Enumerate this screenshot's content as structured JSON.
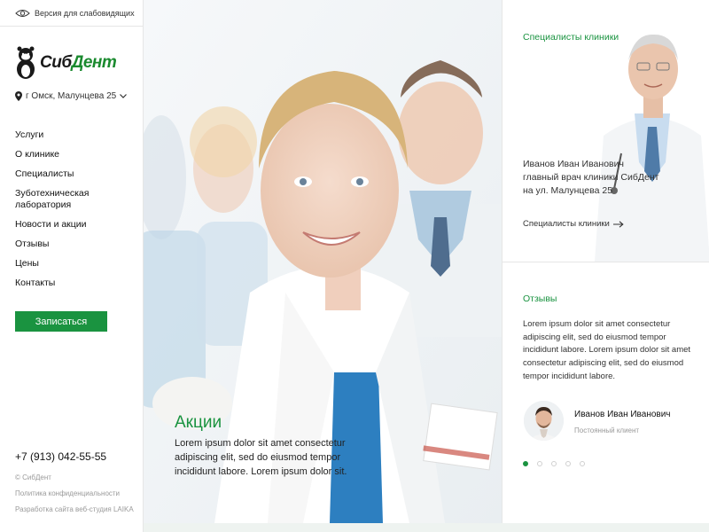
{
  "accessibility": {
    "label": "Версия для слабовидящих",
    "icon": "eye-icon"
  },
  "logo": {
    "text_part1": "Сиб",
    "text_part2": "Дент",
    "icon": "ferret-mascot-icon"
  },
  "location": {
    "text": "г Омск, Малунцева 25",
    "icon": "map-pin-icon"
  },
  "menu": {
    "items": [
      {
        "label": "Услуги"
      },
      {
        "label": "О клинике"
      },
      {
        "label": "Специалисты"
      },
      {
        "label": "Зуботехническая лаборатория"
      },
      {
        "label": "Новости и акции"
      },
      {
        "label": "Отзывы"
      },
      {
        "label": "Цены"
      },
      {
        "label": "Контакты"
      }
    ]
  },
  "cta": {
    "label": "Записаться"
  },
  "footer": {
    "phone": "+7 (913) 042-55-55",
    "copyright": "© СибДент",
    "privacy": "Политика конфиденциальности",
    "dev": "Разработка сайта веб-студия LAIKA"
  },
  "hero": {
    "title": "Акции",
    "text": "Lorem ipsum dolor sit amet consectetur adipiscing elit, sed do eiusmod tempor incididunt labore. Lorem ipsum dolor sit."
  },
  "specialists": {
    "title": "Специалисты клиники",
    "doctor_line1": "Иванов Иван Иванович",
    "doctor_line2": "главный врач клиники СибДент",
    "doctor_line3": "на ул. Малунцева 25",
    "link": "Специалисты клиники"
  },
  "reviews": {
    "title": "Отзывы",
    "text": "Lorem ipsum dolor sit amet consectetur adipiscing elit, sed do eiusmod tempor incididunt labore. Lorem ipsum dolor sit amet consectetur adipiscing elit, sed do eiusmod tempor incididunt labore.",
    "reviewer_name": "Иванов Иван Иванович",
    "reviewer_role": "Постоянный клиент",
    "slides_total": 5,
    "active_slide": 1
  },
  "colors": {
    "accent": "#1a9340",
    "text": "#222222",
    "muted": "#9a9a9a"
  }
}
